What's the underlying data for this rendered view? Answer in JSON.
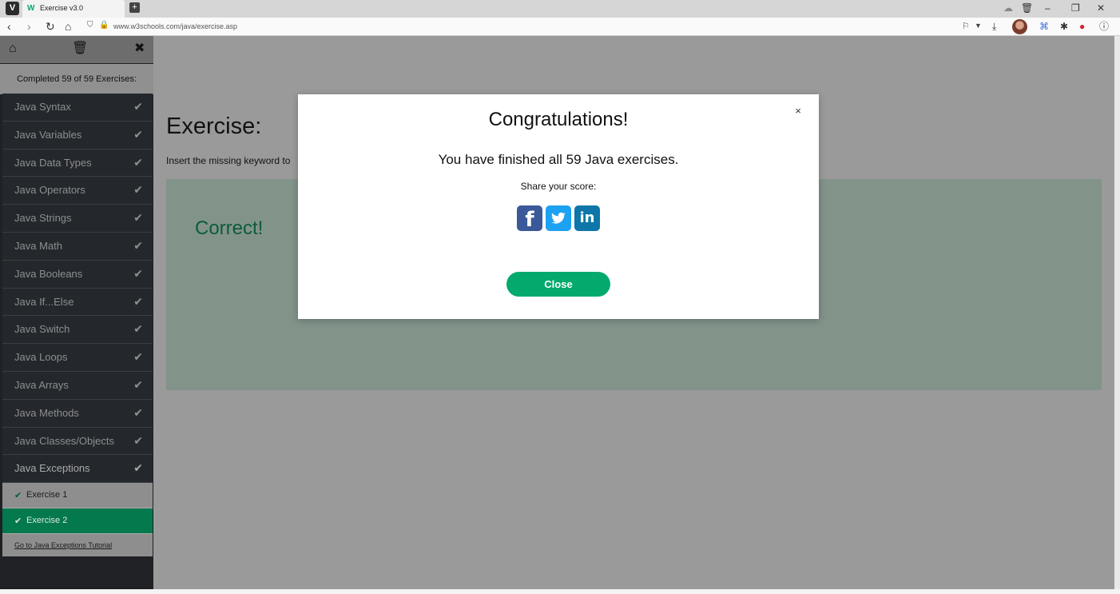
{
  "browser": {
    "tab_title": "Exercise v3.0",
    "url": "www.w3schools.com/java/exercise.asp"
  },
  "sidebar": {
    "progress_text": "Completed 59 of 59 Exercises:",
    "items": [
      {
        "label": "Java Syntax"
      },
      {
        "label": "Java Variables"
      },
      {
        "label": "Java Data Types"
      },
      {
        "label": "Java Operators"
      },
      {
        "label": "Java Strings"
      },
      {
        "label": "Java Math"
      },
      {
        "label": "Java Booleans"
      },
      {
        "label": "Java If...Else"
      },
      {
        "label": "Java Switch"
      },
      {
        "label": "Java Loops"
      },
      {
        "label": "Java Arrays"
      },
      {
        "label": "Java Methods"
      },
      {
        "label": "Java Classes/Objects"
      },
      {
        "label": "Java Exceptions"
      }
    ],
    "subitems": [
      {
        "label": "Exercise 1"
      },
      {
        "label": "Exercise 2"
      }
    ],
    "tutorial_link": "Go to Java Exceptions Tutorial"
  },
  "main": {
    "title": "Exercise:",
    "description": "Insert the missing keyword to",
    "result": "Correct!"
  },
  "modal": {
    "title": "Congratulations!",
    "message": "You have finished all 59 Java exercises.",
    "share_label": "Share your score:",
    "close_x": "×",
    "close_button": "Close"
  },
  "colors": {
    "accent_green": "#04aa6d",
    "facebook_blue": "#3b5998",
    "twitter_blue": "#1da1f2",
    "linkedin_blue": "#0e76a8"
  }
}
